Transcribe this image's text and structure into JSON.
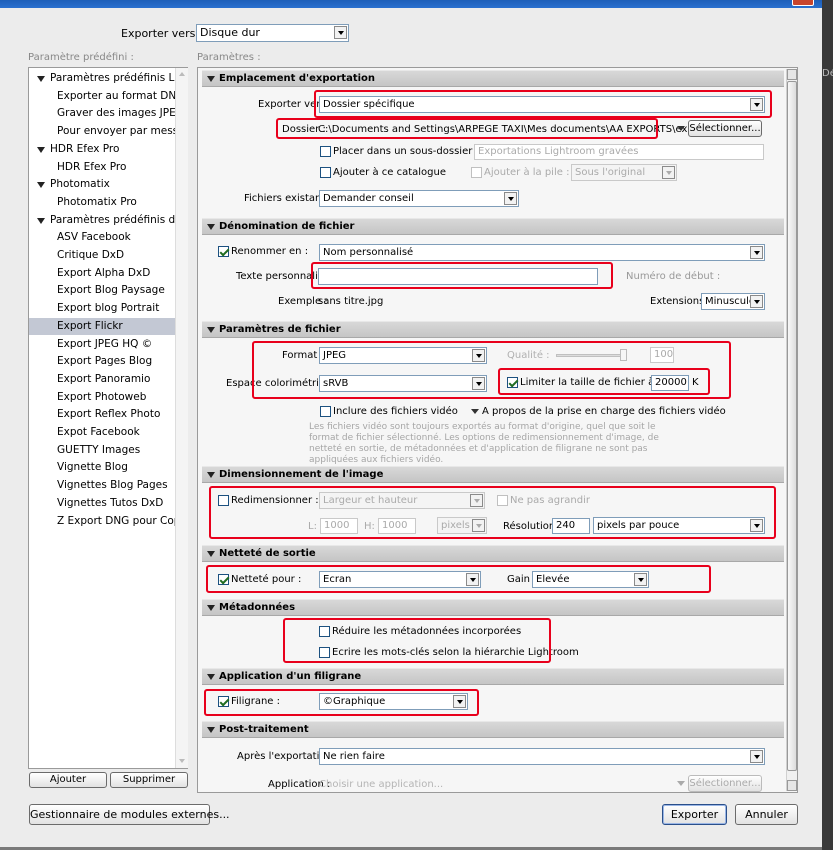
{
  "dialog": {
    "export_to_label": "Exporter vers :",
    "export_to_value": "Disque dur",
    "presets_header": "Paramètre prédéfini :",
    "params_header": "Paramètres :",
    "side_label": "Dév"
  },
  "presets": {
    "tree": [
      {
        "label": "Paramètres prédéfinis Li...",
        "group": true
      },
      {
        "label": "Exporter au format DNG"
      },
      {
        "label": "Graver des images JPE..."
      },
      {
        "label": "Pour envoyer par mess..."
      },
      {
        "label": "HDR Efex Pro",
        "group": true
      },
      {
        "label": "HDR Efex Pro"
      },
      {
        "label": "Photomatix",
        "group": true
      },
      {
        "label": "Photomatix Pro"
      },
      {
        "label": "Paramètres prédéfinis d...",
        "group": true
      },
      {
        "label": "ASV Facebook"
      },
      {
        "label": "Critique DxD"
      },
      {
        "label": "Export Alpha DxD"
      },
      {
        "label": "Export Blog Paysage"
      },
      {
        "label": "Export blog Portrait"
      },
      {
        "label": "Export Flickr",
        "selected": true
      },
      {
        "label": "Export JPEG HQ ©"
      },
      {
        "label": "Export Pages Blog"
      },
      {
        "label": "Export Panoramio"
      },
      {
        "label": "Export Photoweb"
      },
      {
        "label": "Export Reflex Photo"
      },
      {
        "label": "Expot Facebook"
      },
      {
        "label": "GUETTY Images"
      },
      {
        "label": "Vignette Blog"
      },
      {
        "label": "Vignettes Blog Pages"
      },
      {
        "label": "Vignettes Tutos DxD"
      },
      {
        "label": "Z Export DNG pour Copi..."
      }
    ],
    "add_button": "Ajouter",
    "remove_button": "Supprimer"
  },
  "location": {
    "title": "Emplacement d'exportation",
    "export_to_label": "Exporter vers :",
    "export_to_value": "Dossier spécifique",
    "folder_label": "Dossier :",
    "folder_path": "C:\\Documents and Settings\\ARPEGE TAXI\\Mes documents\\AA  EXPORTS\\export flickr",
    "choose_button": "Sélectionner...",
    "subfolder_label": "Placer dans un sous-dossier :",
    "subfolder_value": "Exportations Lightroom gravées",
    "add_catalog_label": "Ajouter à ce catalogue",
    "add_stack_label": "Ajouter à la pile :",
    "stack_value": "Sous l'original",
    "existing_label": "Fichiers existants :",
    "existing_value": "Demander conseil"
  },
  "naming": {
    "title": "Dénomination de fichier",
    "rename_label": "Renommer en :",
    "rename_value": "Nom personnalisé",
    "custom_text_label": "Texte personnalisé :",
    "custom_text_value": "",
    "start_number_label": "Numéro de début :",
    "example_label": "Exemple :",
    "example_value": "sans titre.jpg",
    "extensions_label": "Extensions :",
    "extensions_value": "Minuscules"
  },
  "file_settings": {
    "title": "Paramètres de fichier",
    "format_label": "Format :",
    "format_value": "JPEG",
    "quality_label": "Qualité :",
    "quality_value": "100",
    "quality_level": 100,
    "colorspace_label": "Espace colorimétrique :",
    "colorspace_value": "sRVB",
    "limit_label": "Limiter la taille de fichier à :",
    "limit_value": "20000",
    "limit_unit": "K",
    "include_video_label": "Inclure des fichiers vidéo",
    "video_about_label": "A propos de la prise en charge des fichiers vidéo",
    "video_note": "Les fichiers vidéo sont toujours exportés au format d'origine, quel que soit le format de fichier sélectionné. Les options de redimensionnement d'image, de netteté en sortie, de métadonnées et d'application de filigrane ne sont pas appliquées aux fichiers vidéo."
  },
  "sizing": {
    "title": "Dimensionnement de l'image",
    "resize_label": "Redimensionner :",
    "resize_value": "Largeur et hauteur",
    "dont_enlarge_label": "Ne pas agrandir",
    "w_label": "L:",
    "w_value": "1000",
    "h_label": "H:",
    "h_value": "1000",
    "unit_value": "pixels",
    "resolution_label": "Résolution :",
    "resolution_value": "240",
    "resolution_unit": "pixels par pouce"
  },
  "sharpening": {
    "title": "Netteté de sortie",
    "sharpen_label": "Netteté pour :",
    "sharpen_value": "Ecran",
    "amount_label": "Gain :",
    "amount_value": "Elevée"
  },
  "metadata": {
    "title": "Métadonnées",
    "minimize_label": "Réduire les métadonnées incorporées",
    "hierarchy_label": "Ecrire les mots-clés selon la hiérarchie Lightroom"
  },
  "watermark": {
    "title": "Application d'un filigrane",
    "label": "Filigrane :",
    "value": "©Graphique"
  },
  "post": {
    "title": "Post-traitement",
    "after_label": "Après l'exportation :",
    "after_value": "Ne rien faire",
    "app_label": "Application :",
    "app_placeholder": "Choisir une application...",
    "choose_button": "Sélectionner..."
  },
  "footer": {
    "plugin_button": "Gestionnaire de modules externes...",
    "export_button": "Exporter",
    "cancel_button": "Annuler"
  },
  "colors": {
    "highlight": "#e8001c",
    "selection": "#c3c8d4",
    "title_bar": "#2a70cf"
  }
}
